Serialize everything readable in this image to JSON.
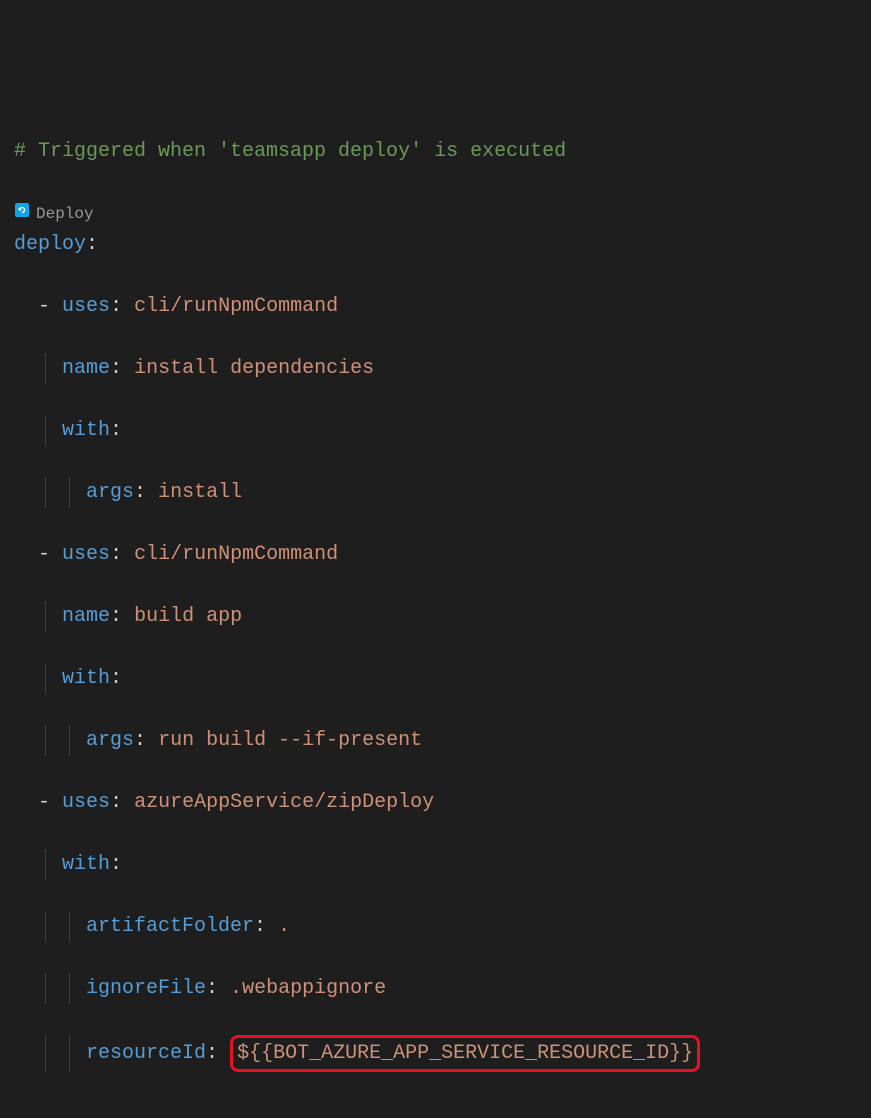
{
  "comment": "# Triggered when 'teamsapp deploy' is executed",
  "codelens": {
    "label": "Deploy"
  },
  "keys": {
    "deploy": "deploy",
    "uses": "uses",
    "name": "name",
    "with": "with",
    "args": "args",
    "artifactFolder": "artifactFolder",
    "ignoreFile": "ignoreFile",
    "resourceId": "resourceId"
  },
  "steps": [
    {
      "uses": "cli/runNpmCommand",
      "name": "install dependencies",
      "args": "install"
    },
    {
      "uses": "cli/runNpmCommand",
      "name": "build app",
      "args": "run build --if-present"
    },
    {
      "uses": "azureAppService/zipDeploy",
      "artifactFolder": ".",
      "ignoreFile": ".webappignore",
      "resourceId": "${{BOT_AZURE_APP_SERVICE_RESOURCE_ID}}"
    }
  ]
}
